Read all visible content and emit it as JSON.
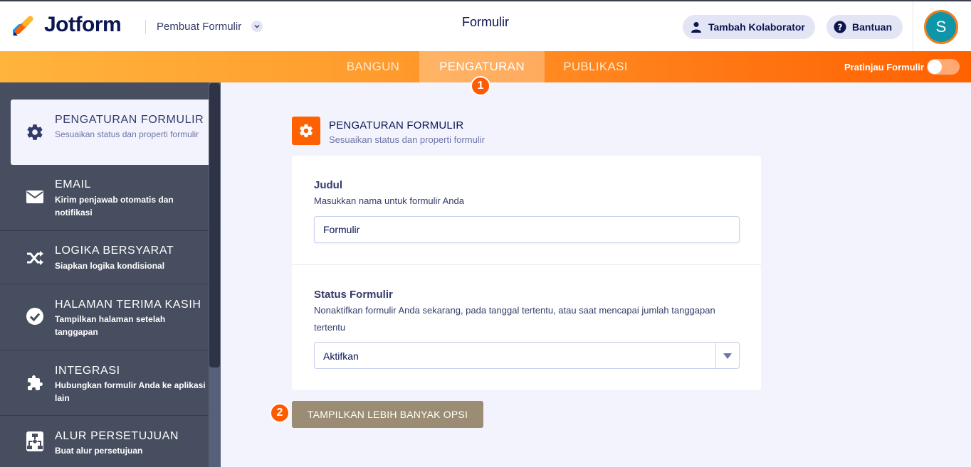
{
  "header": {
    "brand": "Jotform",
    "builder_label": "Pembuat Formulir",
    "title": "Formulir",
    "collab_label": "Tambah Kolaborator",
    "help_label": "Bantuan",
    "avatar_letter": "S"
  },
  "nav": {
    "tabs": [
      {
        "label": "BANGUN",
        "active": false
      },
      {
        "label": "PENGATURAN",
        "active": true
      },
      {
        "label": "PUBLIKASI",
        "active": false
      }
    ],
    "preview_label": "Pratinjau Formulir",
    "preview_on": false
  },
  "badges": {
    "first": "1",
    "second": "2"
  },
  "sidebar": {
    "items": [
      {
        "title": "PENGATURAN FORMULIR",
        "desc": "Sesuaikan status dan properti formulir",
        "icon": "gear-icon",
        "active": true
      },
      {
        "title": "EMAIL",
        "desc": "Kirim penjawab otomatis dan notifikasi",
        "icon": "envelope-icon"
      },
      {
        "title": "LOGIKA BERSYARAT",
        "desc": "Siapkan logika kondisional",
        "icon": "shuffle-icon"
      },
      {
        "title": "HALAMAN TERIMA KASIH",
        "desc": "Tampilkan halaman setelah tanggapan",
        "icon": "check-circle-icon"
      },
      {
        "title": "INTEGRASI",
        "desc": "Hubungkan formulir Anda ke aplikasi lain",
        "icon": "puzzle-icon"
      },
      {
        "title": "ALUR PERSETUJUAN",
        "desc": "Buat alur persetujuan",
        "icon": "flowchart-icon"
      }
    ]
  },
  "main": {
    "section_title": "PENGATURAN FORMULIR",
    "section_sub": "Sesuaikan status dan properti formulir",
    "title_field": {
      "label": "Judul",
      "help": "Masukkan nama untuk formulir Anda",
      "value": "Formulir"
    },
    "status_field": {
      "label": "Status Formulir",
      "help": "Nonaktifkan formulir Anda sekarang, pada tanggal tertentu, atau saat mencapai jumlah tanggapan tertentu",
      "value": "Aktifkan"
    },
    "more_button": "TAMPILKAN LEBIH BANYAK OPSI"
  },
  "colors": {
    "accent": "#ff6100",
    "sidebar_bg": "#474e5f",
    "button_bg": "#9b8c74"
  }
}
